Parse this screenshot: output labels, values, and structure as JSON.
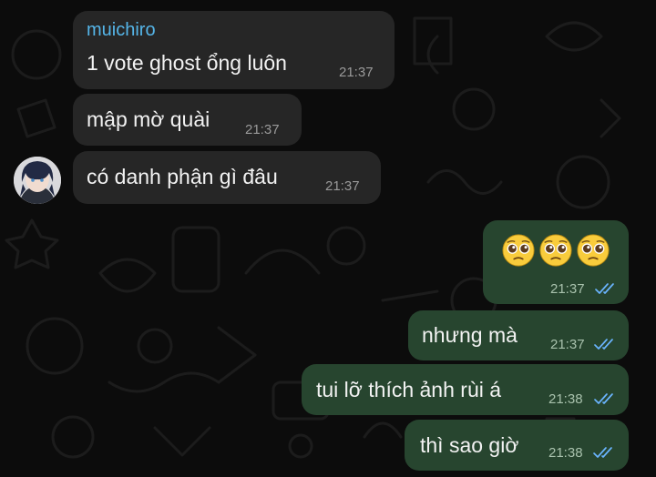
{
  "chat": {
    "incoming": {
      "sender": "muichiro",
      "messages": [
        {
          "text": "1 vote ghost ổng luôn",
          "time": "21:37"
        },
        {
          "text": "mập mờ quài",
          "time": "21:37"
        },
        {
          "text": "có danh phận gì đâu",
          "time": "21:37"
        }
      ]
    },
    "outgoing": {
      "messages": [
        {
          "text": "",
          "emoji": [
            "pleading-face",
            "pleading-face",
            "pleading-face"
          ],
          "time": "21:37",
          "status": "read"
        },
        {
          "text": "nhưng mà",
          "time": "21:37",
          "status": "read"
        },
        {
          "text": "tui lỡ thích ảnh rùi á",
          "time": "21:38",
          "status": "read"
        },
        {
          "text": "thì sao giờ",
          "time": "21:38",
          "status": "read"
        }
      ]
    }
  },
  "colors": {
    "background": "#0c0c0c",
    "incoming_bubble": "#262626",
    "outgoing_bubble": "#27452f",
    "sender_name": "#55b5e8",
    "read_ticks": "#6ab4ff"
  }
}
